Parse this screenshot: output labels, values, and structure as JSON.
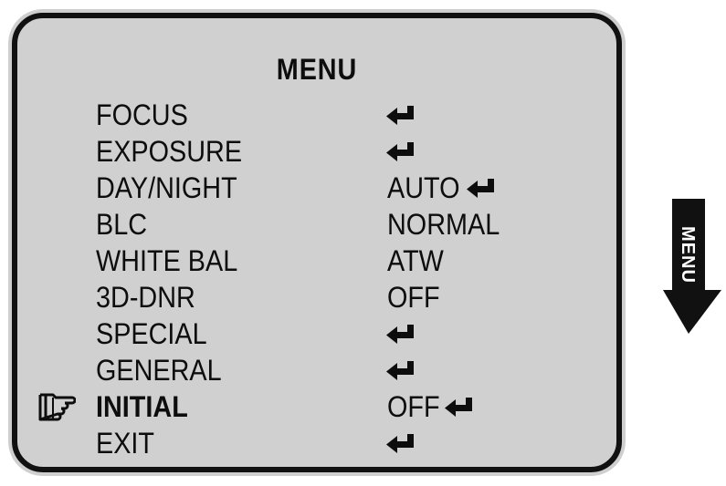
{
  "menu": {
    "title": "MENU",
    "items": [
      {
        "label": "FOCUS",
        "value": "",
        "icon": "enter-arrow-icon"
      },
      {
        "label": "EXPOSURE",
        "value": "",
        "icon": "enter-arrow-icon"
      },
      {
        "label": "DAY/NIGHT",
        "value": "AUTO",
        "icon": "enter-arrow-icon"
      },
      {
        "label": "BLC",
        "value": "NORMAL",
        "icon": ""
      },
      {
        "label": "WHITE BAL",
        "value": "ATW",
        "icon": ""
      },
      {
        "label": "3D-DNR",
        "value": "OFF",
        "icon": ""
      },
      {
        "label": "SPECIAL",
        "value": "",
        "icon": "enter-arrow-icon"
      },
      {
        "label": "GENERAL",
        "value": "",
        "icon": "enter-arrow-icon"
      },
      {
        "label": "INITIAL",
        "value": "OFF",
        "icon": "enter-arrow-icon",
        "selected": true
      },
      {
        "label": "EXIT",
        "value": "",
        "icon": "enter-arrow-icon"
      }
    ],
    "cursor_icon": "pointing-hand-icon"
  },
  "side_key": {
    "label": "MENU",
    "icon": "down-arrow-icon"
  },
  "colors": {
    "screen_background": "#d0d0d0",
    "text": "#0d0d0d",
    "border": "#111111"
  }
}
